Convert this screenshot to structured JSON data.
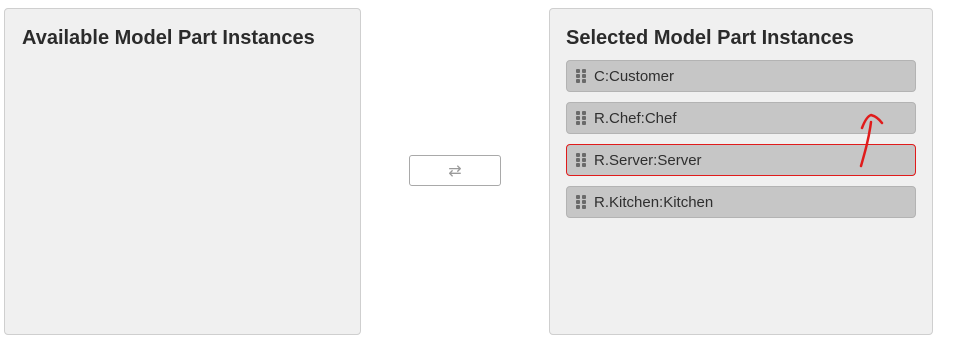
{
  "available_panel": {
    "title": "Available Model Part Instances",
    "items": []
  },
  "selected_panel": {
    "title": "Selected Model Part Instances",
    "items": [
      {
        "label": "C:Customer"
      },
      {
        "label": "R.Chef:Chef"
      },
      {
        "label": "R.Server:Server"
      },
      {
        "label": "R.Kitchen:Kitchen"
      }
    ]
  },
  "swap_button": {
    "icon": "swap-arrows-icon",
    "glyph": "⇄"
  },
  "colors": {
    "highlight_border": "#e01b1b",
    "annotation_arrow": "#e01b1b"
  }
}
